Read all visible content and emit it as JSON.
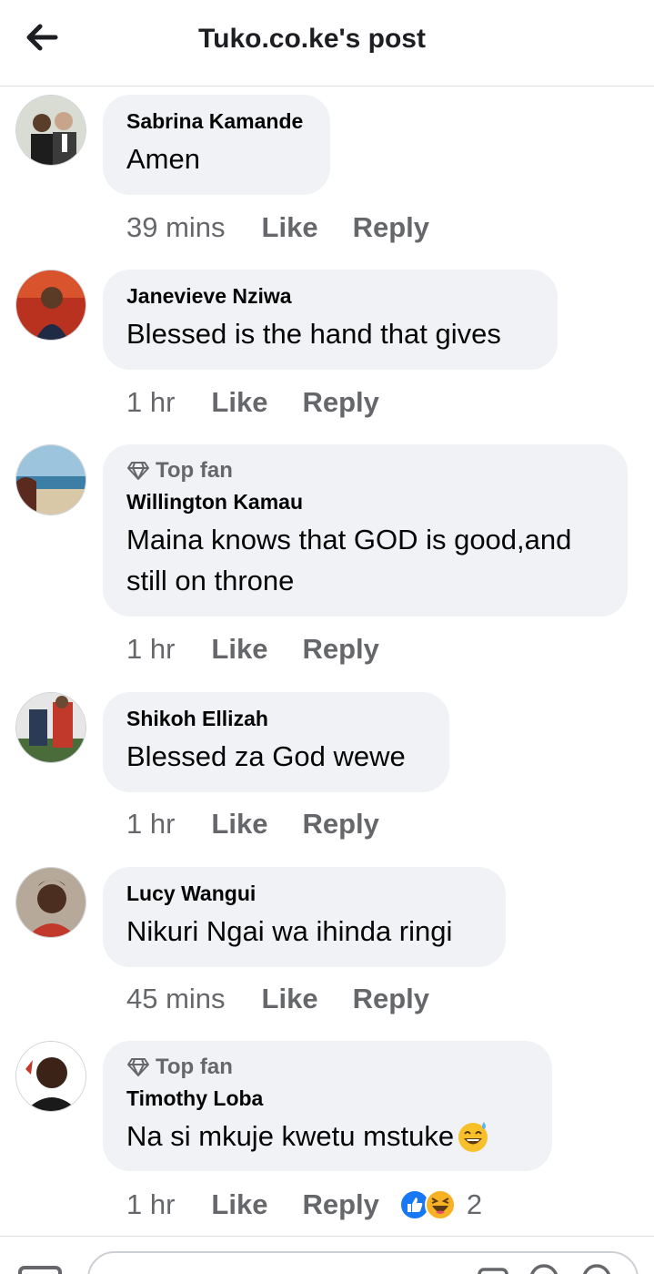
{
  "header": {
    "title": "Tuko.co.ke's post",
    "back_icon": "arrow-left-icon"
  },
  "comments": [
    {
      "author": "Sabrina Kamande",
      "text": "Amen",
      "time": "39 mins",
      "like": "Like",
      "reply": "Reply",
      "top_fan": false
    },
    {
      "author": "Janevieve Nziwa",
      "text": "Blessed is the hand that gives",
      "time": "1 hr",
      "like": "Like",
      "reply": "Reply",
      "top_fan": false
    },
    {
      "badge": "Top fan",
      "author": "Willington Kamau",
      "text_line1": "Maina knows that GOD is good,and",
      "text_line2": "still on throne",
      "time": "1 hr",
      "like": "Like",
      "reply": "Reply",
      "top_fan": true
    },
    {
      "author": "Shikoh Ellizah",
      "text": "Blessed za God wewe",
      "time": "1 hr",
      "like": "Like",
      "reply": "Reply",
      "top_fan": false
    },
    {
      "author": "Lucy Wangui",
      "text": "Nikuri Ngai wa ihinda ringi",
      "time": "45 mins",
      "like": "Like",
      "reply": "Reply",
      "top_fan": false
    },
    {
      "badge": "Top fan",
      "author": "Timothy Loba",
      "text": "Na si mkuje kwetu mstuke",
      "emoji": "grinning-sweat-emoji",
      "time": "1 hr",
      "like": "Like",
      "reply": "Reply",
      "top_fan": true,
      "reactions": {
        "types": [
          "like-reaction-icon",
          "haha-reaction-icon"
        ],
        "count": "2"
      }
    }
  ],
  "colors": {
    "bubble": "#f0f2f5",
    "meta": "#65676b",
    "like_blue": "#1877f2",
    "haha_yellow": "#f7b125"
  }
}
